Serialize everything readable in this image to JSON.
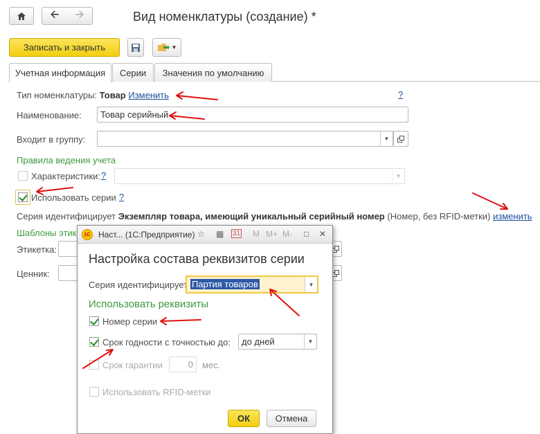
{
  "window": {
    "title": "Вид номенклатуры  (создание) *"
  },
  "nav": {
    "home_icon": "home-icon",
    "back_icon": "arrow-left-icon",
    "forward_icon": "arrow-right-icon"
  },
  "toolbar": {
    "save_close_label": "Записать и закрыть"
  },
  "tabs": [
    {
      "label": "Учетная информация",
      "active": true
    },
    {
      "label": "Серии",
      "active": false
    },
    {
      "label": "Значения по умолчанию",
      "active": false
    }
  ],
  "form": {
    "type_label": "Тип номенклатуры:",
    "type_value": "Товар",
    "type_change_link": "Изменить",
    "help": "?",
    "name_label": "Наименование:",
    "name_value": "Товар серийный",
    "group_label": "Входит в группу:",
    "group_value": "",
    "rules_heading": "Правила ведения учета",
    "characteristics_label": "Характеристики:",
    "characteristics_checked": false,
    "use_series_label": "Использовать серии",
    "use_series_checked": true,
    "series_identifies_prefix": "Серия идентифицирует",
    "series_identifies_value": "Экземпляр товара, имеющий уникальный серийный номер",
    "series_identifies_suffix": "(Номер, без RFID-метки)",
    "series_change_link": "изменить",
    "templates_heading": "Шаблоны этике",
    "label_label": "Этикетка:",
    "price_tag_label": "Ценник:"
  },
  "dialog": {
    "titlebar": "Наст...  (1С:Предприятие)",
    "toolbar_icons": [
      "star-icon",
      "calculator-icon",
      "calendar-icon"
    ],
    "m_buttons": [
      "M",
      "M+",
      "M-"
    ],
    "heading": "Настройка состава реквизитов серии",
    "identifies_label": "Серия идентифицирует:",
    "identifies_value": "Партия товаров",
    "use_attrs_heading": "Использовать реквизиты",
    "series_number_label": "Номер серии",
    "series_number_checked": true,
    "expiry_label": "Срок годности с точностью до:",
    "expiry_checked": true,
    "expiry_value": "до дней",
    "warranty_label": "Срок гарантии",
    "warranty_value": "0",
    "warranty_unit": "мес.",
    "rfid_label": "Использовать RFID-метки",
    "ok_label": "ОК",
    "cancel_label": "Отмена"
  },
  "colors": {
    "accent_yellow": "#f2cf10",
    "green_heading": "#3d9a3d",
    "link_blue": "#1a4fa0",
    "annotation_red": "#e01010"
  }
}
